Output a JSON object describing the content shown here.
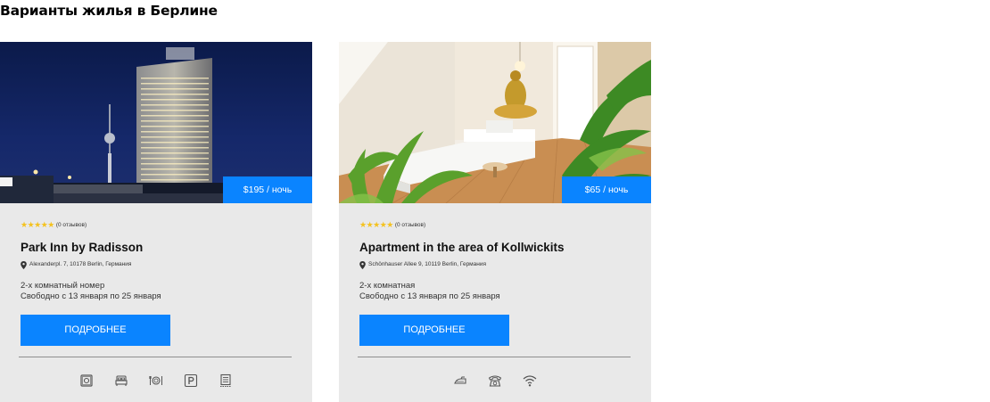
{
  "section": {
    "title": "Варианты жилья в Берлине"
  },
  "colors": {
    "accent": "#0a84ff",
    "star": "#f4c21f",
    "card_bg": "#e9e9e9"
  },
  "listings": [
    {
      "price": "$195 / ночь",
      "rating_stars": "★★★★★",
      "reviews": "(0 отзывов)",
      "title": "Park Inn by Radisson",
      "address": "Alexanderpl. 7, 10178 Berlin, Германия",
      "room_type": "2-х комнатный номер",
      "availability": "Свободно с 13 января по 25 января",
      "button_label": "ПОДРОБНЕЕ",
      "photo": "hotel-tower-night-photo",
      "amenities": [
        "safe-icon",
        "bed-icon",
        "restaurant-icon",
        "parking-icon",
        "laundry-icon"
      ]
    },
    {
      "price": "$65 / ночь",
      "rating_stars": "★★★★★",
      "reviews": "(0 отзывов)",
      "title": "Apartment in the area of Kollwickits",
      "address": "Schönhauser Allee 9, 10119 Berlin, Германия",
      "room_type": "2-х комнатная",
      "availability": "Свободно с 13 января по 25 января",
      "button_label": "ПОДРОБНЕЕ",
      "photo": "apartment-living-room-photo",
      "amenities": [
        "iron-icon",
        "phone-icon",
        "wifi-icon"
      ]
    }
  ]
}
